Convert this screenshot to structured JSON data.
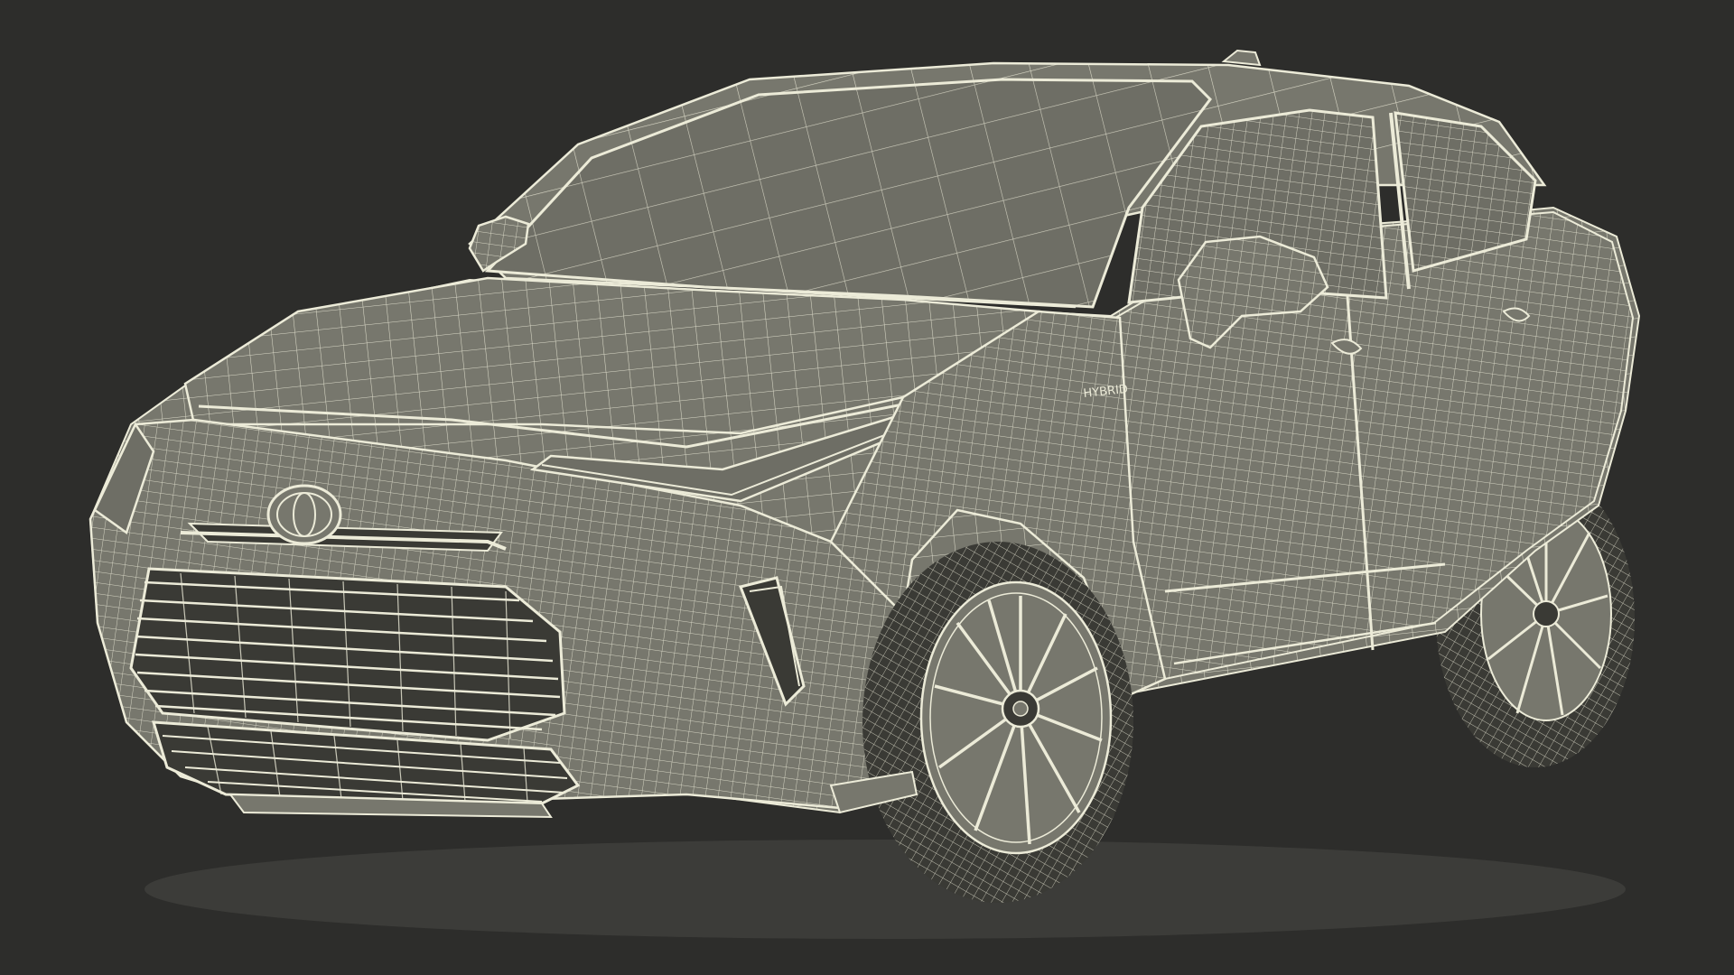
{
  "scene": {
    "subject": "suv-wireframe-render",
    "view": "front-three-quarter",
    "background_color": "#2d2d2b",
    "surface_color": "#77776d",
    "surface_shadow_color": "#5a5a52",
    "wire_color": "#ecebd8",
    "glass_color": "#6e6e65",
    "dark_color": "#3a3a35"
  },
  "badges": {
    "fender_badge": "HYBRID"
  }
}
